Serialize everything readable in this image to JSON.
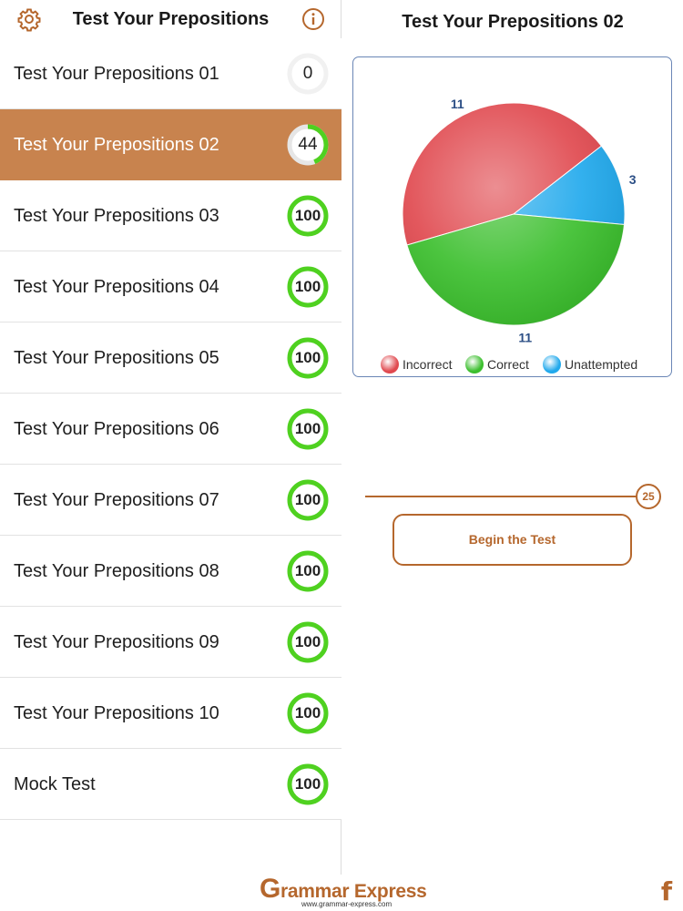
{
  "left_panel": {
    "title": "Test Your Prepositions",
    "icons": [
      "gear-icon",
      "info-icon"
    ],
    "items": [
      {
        "label": "Test Your Prepositions 01",
        "score": "0"
      },
      {
        "label": "Test Your Prepositions 02",
        "score": "44",
        "selected": true
      },
      {
        "label": "Test Your Prepositions 03",
        "score": "100"
      },
      {
        "label": "Test Your Prepositions 04",
        "score": "100"
      },
      {
        "label": "Test Your Prepositions 05",
        "score": "100"
      },
      {
        "label": "Test Your Prepositions 06",
        "score": "100"
      },
      {
        "label": "Test Your Prepositions 07",
        "score": "100"
      },
      {
        "label": "Test Your Prepositions 08",
        "score": "100"
      },
      {
        "label": "Test Your Prepositions 09",
        "score": "100"
      },
      {
        "label": "Test Your Prepositions 10",
        "score": "100"
      },
      {
        "label": "Mock Test",
        "score": "100"
      }
    ]
  },
  "right_panel": {
    "title": "Test Your Prepositions 02",
    "slider_value": "25",
    "begin_button": "Begin the Test"
  },
  "chart_data": {
    "type": "pie",
    "slices": [
      {
        "name": "Incorrect",
        "value": 11,
        "color": "#e0494f"
      },
      {
        "name": "Unattempted",
        "value": 3,
        "color": "#21a9ec"
      },
      {
        "name": "Correct",
        "value": 11,
        "color": "#3cbf2e"
      }
    ],
    "legend": [
      "Incorrect",
      "Correct",
      "Unattempted"
    ],
    "legend_placement": "bottom"
  },
  "footer": {
    "logo_initial": "G",
    "logo_text": "rammar Express",
    "logo_url": "www.grammar-express.com",
    "facebook_glyph": "f"
  },
  "colors": {
    "accent": "#b5672d",
    "selected_row": "#c8834e",
    "ring_green": "#4fd120",
    "incorrect": "#e0494f",
    "correct": "#3cbf2e",
    "unattempted": "#21a9ec"
  }
}
